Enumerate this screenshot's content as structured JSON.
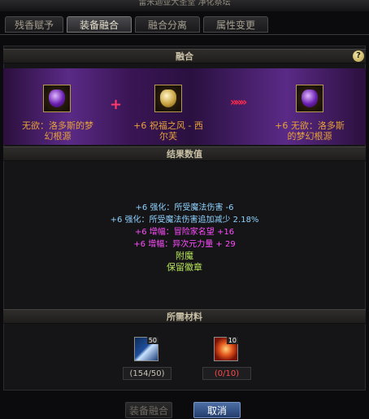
{
  "window": {
    "title": "雷米迦亚大圣堂 净化祭坛"
  },
  "tabs": [
    {
      "label": "残香赋予",
      "active": false
    },
    {
      "label": "装备融合",
      "active": true
    },
    {
      "label": "融合分离",
      "active": false
    },
    {
      "label": "属性变更",
      "active": false
    }
  ],
  "sections": {
    "fusion": "融合",
    "result": "结果数值",
    "materials": "所需材料"
  },
  "help_label": "?",
  "fusion": {
    "item_a": {
      "label_line1": "无欲：洛多斯的梦",
      "label_line2": "幻根源",
      "icon": "purple-gem-orb-icon"
    },
    "item_b": {
      "label_line1": "+6 祝福之风 - 西",
      "label_line2": "尔芙",
      "icon": "golden-charm-icon"
    },
    "item_result": {
      "label_line1": "+6 无欲：洛多斯",
      "label_line2": "的梦幻根源",
      "icon": "purple-gem-orb-icon"
    },
    "plus_symbol": "+",
    "arrow_symbol": "»»»"
  },
  "result_stats": [
    {
      "text": "+6 强化：所受魔法伤害 -6",
      "color": "#8fd2ff"
    },
    {
      "text": "+6 强化：所受魔法伤害追加减少 2.18%",
      "color": "#8fd2ff"
    },
    {
      "text": "+6 增幅：冒险家名望 +16",
      "color": "#ff4cff"
    },
    {
      "text": "+6 增幅：异次元力量 + 29",
      "color": "#ff4cff"
    },
    {
      "text": "附魔",
      "color": "#b6e35a"
    },
    {
      "text": "保留徽章",
      "color": "#b6e35a"
    }
  ],
  "materials": [
    {
      "icon": "blue-crystal-shard-icon",
      "badge": "50",
      "count_text": "(154/50)",
      "count_color": "#c9c3b4"
    },
    {
      "icon": "red-fire-orb-icon",
      "badge": "10",
      "count_text": "(0/10)",
      "count_color": "#ff4a4a"
    }
  ],
  "buttons": {
    "fuse": "装备融合",
    "cancel": "取消"
  },
  "colors": {
    "accent_orange": "#e8a23a",
    "enhance_blue": "#8fd2ff",
    "amplify_magenta": "#ff4cff",
    "green": "#b6e35a",
    "deficit_red": "#ff4a4a"
  }
}
